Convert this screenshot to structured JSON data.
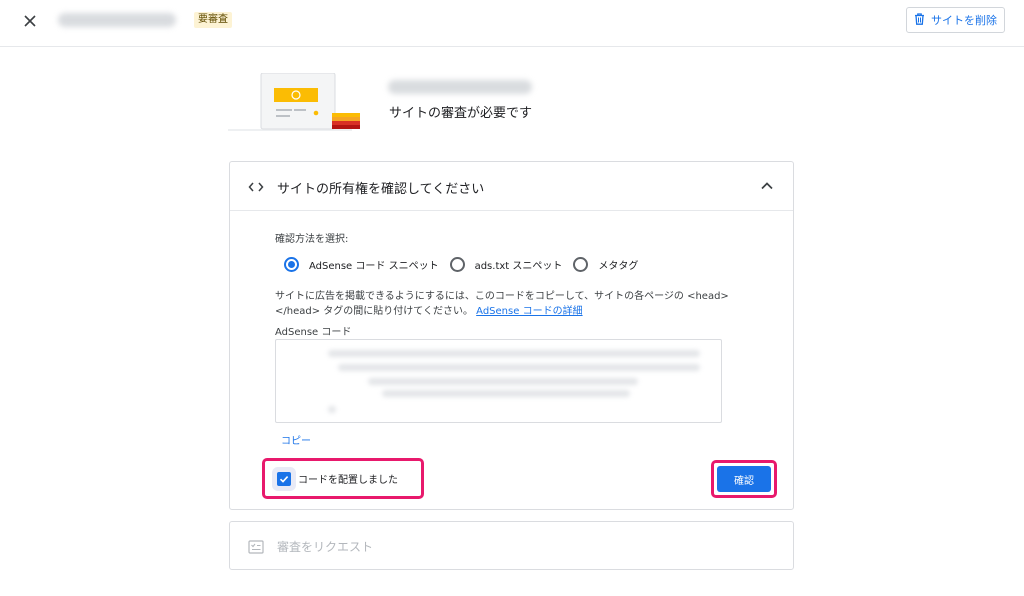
{
  "header": {
    "status_badge": "要審査",
    "delete_button_label": "サイトを削除"
  },
  "summary": {
    "status_text": "サイトの審査が必要です"
  },
  "verify_card": {
    "title": "サイトの所有権を確認してください",
    "method_label": "確認方法を選択:",
    "methods": [
      {
        "label": "AdSense コード スニペット",
        "selected": true
      },
      {
        "label": "ads.txt スニペット",
        "selected": false
      },
      {
        "label": "メタタグ",
        "selected": false
      }
    ],
    "description_line1": "サイトに広告を掲載できるようにするには、このコードをコピーして、サイトの各ページの <head>",
    "description_line2": "</head> タグの間に貼り付けてください。",
    "details_link": "AdSense コードの詳細",
    "code_label": "AdSense コード",
    "copy_label": "コピー",
    "checkbox_label": "コードを配置しました",
    "checkbox_checked": true,
    "confirm_label": "確認"
  },
  "request_card": {
    "title": "審査をリクエスト"
  },
  "colors": {
    "accent": "#1a73e8",
    "highlight": "#e8196c",
    "badge_bg": "#fdf3d4"
  }
}
